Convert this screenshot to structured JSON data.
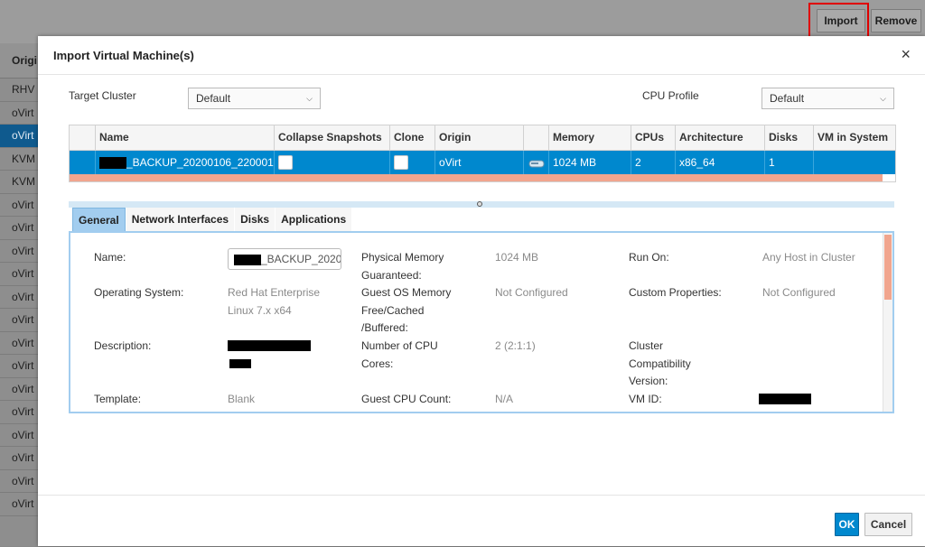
{
  "background": {
    "buttons": {
      "import": "Import",
      "remove": "Remove"
    },
    "column": {
      "header": "Origi",
      "rows": [
        "RHV",
        "oVirt",
        "oVirt",
        "KVM",
        "KVM",
        "oVirt",
        "oVirt",
        "oVirt",
        "oVirt",
        "oVirt",
        "oVirt",
        "oVirt",
        "oVirt",
        "oVirt",
        "oVirt",
        "oVirt",
        "oVirt",
        "oVirt",
        "oVirt"
      ],
      "selected_index": 2
    }
  },
  "modal": {
    "title": "Import Virtual Machine(s)",
    "close_icon": "×",
    "target_cluster": {
      "label": "Target Cluster",
      "value": "Default"
    },
    "cpu_profile": {
      "label": "CPU Profile",
      "value": "Default"
    },
    "table": {
      "headers": [
        "",
        "Name",
        "Collapse Snapshots",
        "Clone",
        "Origin",
        "",
        "Memory",
        "CPUs",
        "Architecture",
        "Disks",
        "VM in System"
      ],
      "row": {
        "name": "_BACKUP_20200106_220001",
        "origin": "oVirt",
        "memory": "1024 MB",
        "cpus": "2",
        "architecture": "x86_64",
        "disks": "1"
      }
    },
    "tabs": [
      "General",
      "Network Interfaces",
      "Disks",
      "Applications"
    ],
    "general": {
      "name_label": "Name:",
      "name_value": "_BACKUP_2020(",
      "os_label": "Operating System:",
      "os_value_1": "Red Hat Enterprise",
      "os_value_2": "Linux 7.x x64",
      "description_label": "Description:",
      "template_label": "Template:",
      "template_value": "Blank",
      "phys_mem_label_1": "Physical Memory",
      "phys_mem_label_2": "Guaranteed:",
      "phys_mem_value": "1024 MB",
      "guest_mem_label_1": "Guest OS Memory",
      "guest_mem_label_2": "Free/Cached",
      "guest_mem_label_3": "/Buffered:",
      "guest_mem_value": "Not Configured",
      "cpu_cores_label_1": "Number of CPU",
      "cpu_cores_label_2": "Cores:",
      "cpu_cores_value": "2 (2:1:1)",
      "guest_cpu_label": "Guest CPU Count:",
      "guest_cpu_value": "N/A",
      "run_on_label": "Run On:",
      "run_on_value": "Any Host in Cluster",
      "custom_props_label": "Custom Properties:",
      "custom_props_value": "Not Configured",
      "compat_label_1": "Cluster",
      "compat_label_2": "Compatibility",
      "compat_label_3": "Version:",
      "vm_id_label": "VM ID:"
    },
    "footer": {
      "ok": "OK",
      "cancel": "Cancel"
    }
  }
}
